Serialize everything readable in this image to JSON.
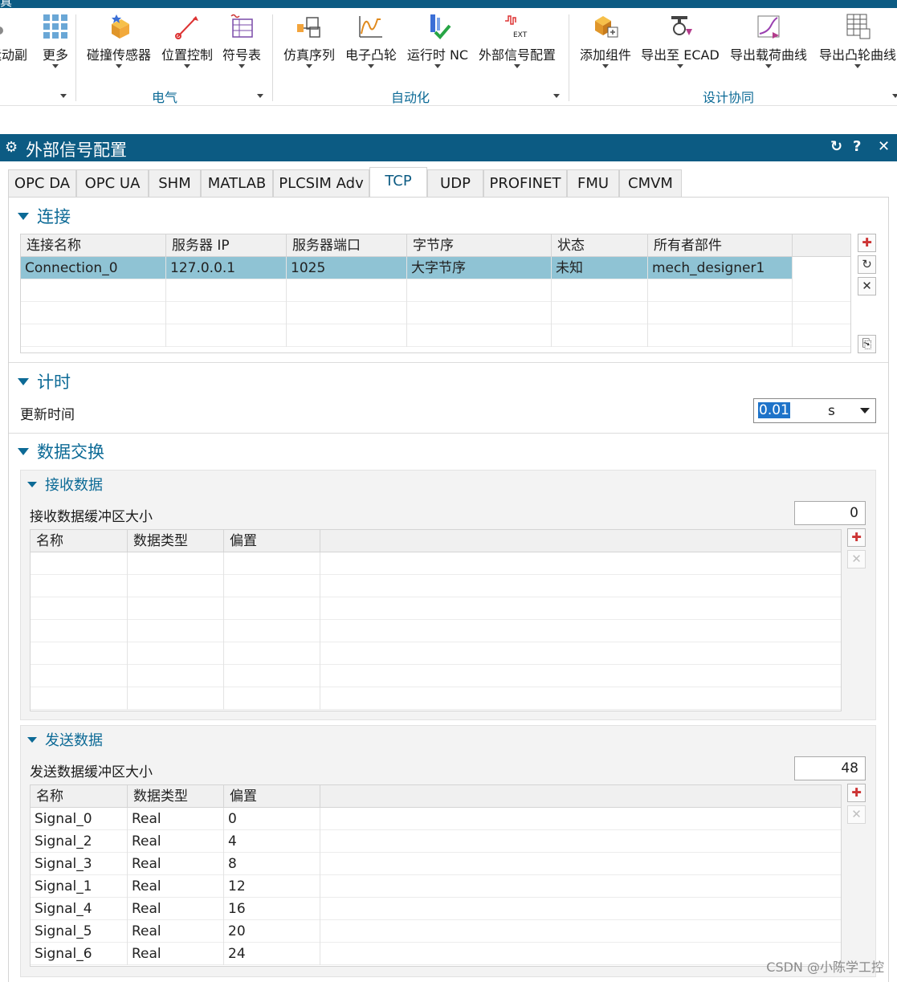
{
  "ribbon": {
    "partial_top_text": "真",
    "buttons": [
      {
        "label": "运动副",
        "icon": "joint-icon"
      },
      {
        "label": "更多",
        "icon": "more-grid-icon"
      },
      {
        "label": "碰撞传感器",
        "icon": "collision-sensor-icon"
      },
      {
        "label": "位置控制",
        "icon": "position-control-icon"
      },
      {
        "label": "符号表",
        "icon": "symbol-table-icon"
      },
      {
        "label": "仿真序列",
        "icon": "simulation-sequence-icon"
      },
      {
        "label": "电子凸轮",
        "icon": "electronic-cam-icon"
      },
      {
        "label": "运行时 NC",
        "icon": "runtime-nc-icon"
      },
      {
        "label": "外部信号配置",
        "icon": "external-signal-icon"
      },
      {
        "label": "添加组件",
        "icon": "add-component-icon"
      },
      {
        "label": "导出至 ECAD",
        "icon": "export-ecad-icon"
      },
      {
        "label": "导出载荷曲线",
        "icon": "export-load-curve-icon"
      },
      {
        "label": "导出凸轮曲线",
        "icon": "export-cam-curve-icon"
      }
    ],
    "groups": [
      "电气",
      "自动化",
      "设计协同"
    ]
  },
  "dialog": {
    "title": "外部信号配置",
    "tabs": [
      "OPC DA",
      "OPC UA",
      "SHM",
      "MATLAB",
      "PLCSIM Adv",
      "TCP",
      "UDP",
      "PROFINET",
      "FMU",
      "CMVM"
    ],
    "active_tab": "TCP",
    "connection": {
      "section_title": "连接",
      "columns": [
        "连接名称",
        "服务器 IP",
        "服务器端口",
        "字节序",
        "状态",
        "所有者部件"
      ],
      "rows": [
        [
          "Connection_0",
          "127.0.0.1",
          "1025",
          "大字节序",
          "未知",
          "mech_designer1"
        ]
      ]
    },
    "timing": {
      "section_title": "计时",
      "update_label": "更新时间",
      "update_value": "0.01",
      "unit": "s"
    },
    "data_exchange": {
      "section_title": "数据交换",
      "receive": {
        "title": "接收数据",
        "buffer_label": "接收数据缓冲区大小",
        "buffer_value": "0",
        "columns": [
          "名称",
          "数据类型",
          "偏置"
        ],
        "rows": []
      },
      "send": {
        "title": "发送数据",
        "buffer_label": "发送数据缓冲区大小",
        "buffer_value": "48",
        "columns": [
          "名称",
          "数据类型",
          "偏置"
        ],
        "rows": [
          [
            "Signal_0",
            "Real",
            "0"
          ],
          [
            "Signal_2",
            "Real",
            "4"
          ],
          [
            "Signal_3",
            "Real",
            "8"
          ],
          [
            "Signal_1",
            "Real",
            "12"
          ],
          [
            "Signal_4",
            "Real",
            "16"
          ],
          [
            "Signal_5",
            "Real",
            "20"
          ],
          [
            "Signal_6",
            "Real",
            "24"
          ]
        ]
      }
    }
  },
  "watermark": "CSDN @小陈学工控",
  "colors": {
    "titlebar": "#0c5b83",
    "accent": "#0c6a96",
    "selected_row": "#8fc3d4"
  }
}
